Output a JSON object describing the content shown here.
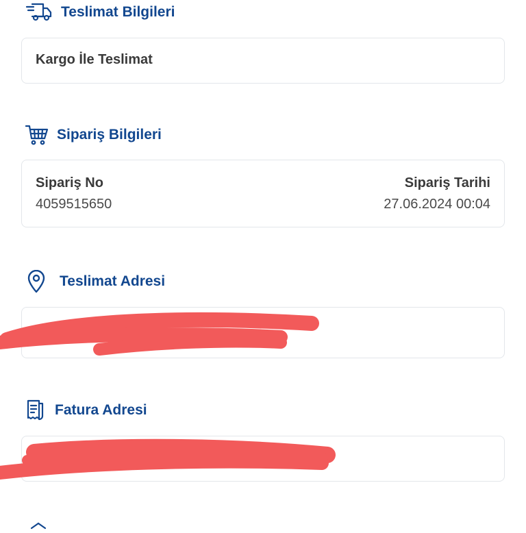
{
  "delivery": {
    "title": "Teslimat Bilgileri",
    "method": "Kargo İle Teslimat",
    "icon": "delivery-truck-icon"
  },
  "order": {
    "title": "Sipariş Bilgileri",
    "icon": "shopping-cart-icon",
    "number_label": "Sipariş No",
    "number_value": "4059515650",
    "date_label": "Sipariş Tarihi",
    "date_value": "27.06.2024 00:04"
  },
  "shipping_address": {
    "title": "Teslimat Adresi",
    "icon": "location-pin-icon"
  },
  "billing_address": {
    "title": "Fatura Adresi",
    "icon": "receipt-icon"
  },
  "colors": {
    "accent": "#12478f",
    "redaction": "#f25a5a",
    "card_border": "#e3e6ea"
  }
}
